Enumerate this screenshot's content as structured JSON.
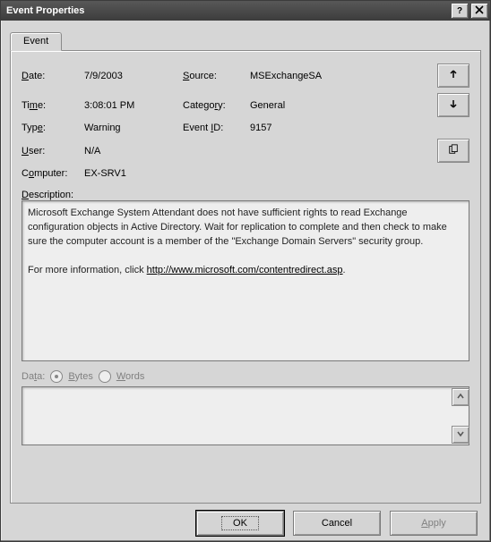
{
  "title": "Event Properties",
  "tab": {
    "label": "Event"
  },
  "labels": {
    "date": "Date:",
    "time": "Time:",
    "type": "Type:",
    "user": "User:",
    "computer": "Computer:",
    "source": "Source:",
    "category": "Category:",
    "event_id": "Event ID:",
    "description": "Description:",
    "data": "Data:",
    "bytes": "Bytes",
    "words": "Words"
  },
  "values": {
    "date": "7/9/2003",
    "time": "3:08:01 PM",
    "type": "Warning",
    "user": "N/A",
    "computer": "EX-SRV1",
    "source": "MSExchangeSA",
    "category": "General",
    "event_id": "9157"
  },
  "description": {
    "body": "Microsoft Exchange System Attendant does not have sufficient rights to read Exchange configuration objects in Active Directory. Wait for replication to complete and then check to make sure the computer account is a member of the \"Exchange Domain Servers\" security group.",
    "more_prefix": "For more information, click ",
    "link_text": "http://www.microsoft.com/contentredirect.asp",
    "suffix": "."
  },
  "buttons": {
    "ok": "OK",
    "cancel": "Cancel",
    "apply": "Apply"
  }
}
